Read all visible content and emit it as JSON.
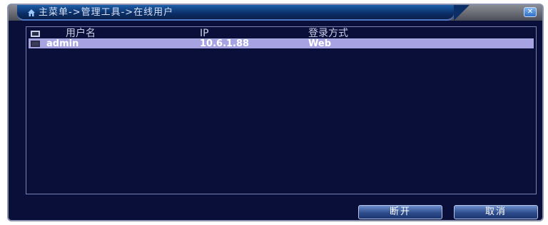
{
  "window": {
    "breadcrumb": "主菜单->管理工具->在线用户",
    "close_label": "✕",
    "icon": "home-icon"
  },
  "table": {
    "columns": [
      "用户名",
      "IP",
      "登录方式"
    ],
    "rows": [
      {
        "username": "admin",
        "ip": "10.6.1.88",
        "login_method": "Web",
        "selected": true
      }
    ]
  },
  "buttons": {
    "disconnect": "断开",
    "cancel": "取消"
  },
  "colors": {
    "background": "#0a0f3a",
    "selected_row": "#a7a2e2",
    "title_accent": "#1c5ea8"
  }
}
